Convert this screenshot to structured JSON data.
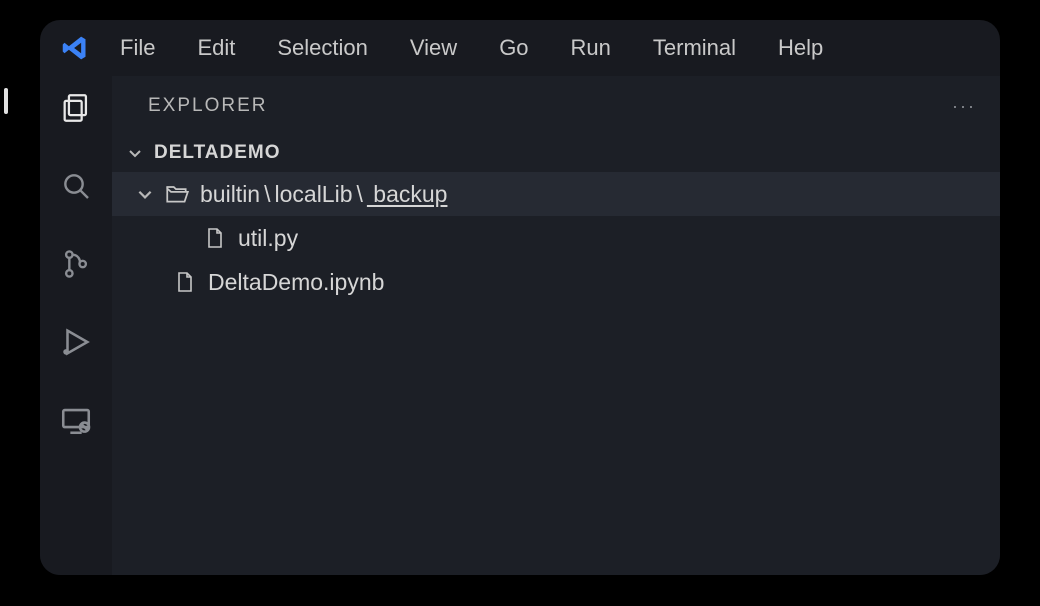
{
  "menubar": {
    "items": [
      "File",
      "Edit",
      "Selection",
      "View",
      "Go",
      "Run",
      "Terminal",
      "Help"
    ]
  },
  "activitybar": {
    "items": [
      {
        "name": "explorer-icon",
        "active": true
      },
      {
        "name": "search-icon",
        "active": false
      },
      {
        "name": "sourcecontrol-icon",
        "active": false
      },
      {
        "name": "run-debug-icon",
        "active": false
      },
      {
        "name": "remote-icon",
        "active": false
      }
    ]
  },
  "sidebar": {
    "title": "EXPLORER",
    "more_label": "···",
    "section_title": "DELTADEMO",
    "tree": {
      "folder_open": true,
      "folder_path": {
        "seg1": "builtin",
        "seg2": "localLib",
        "seg3_underlined": "  backup"
      },
      "children": [
        {
          "name": "util.py",
          "indent": "indent1"
        },
        {
          "name": "DeltaDemo.ipynb",
          "indent": "indent0f"
        }
      ]
    }
  }
}
